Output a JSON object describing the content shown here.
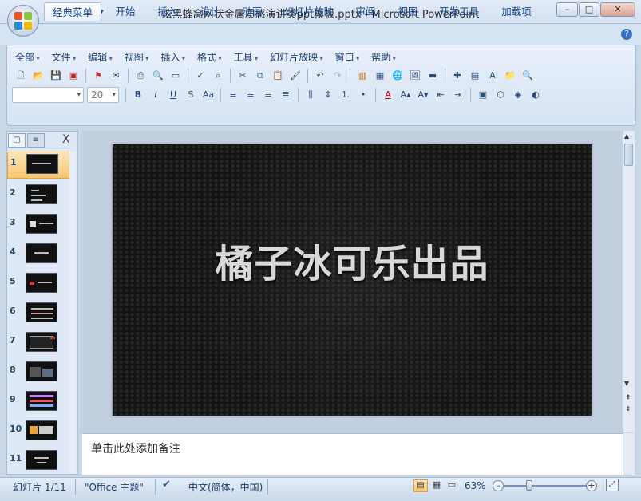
{
  "window": {
    "title": "炫黑蜂窝网状金属质感演讲类ppt模板.pptx - Microsoft PowerPoint",
    "minimize_icon": "minimize-icon",
    "maximize_icon": "maximize-icon",
    "close_icon": "close-icon"
  },
  "quick_access": [
    "save-icon",
    "undo-icon",
    "redo-icon",
    "customize-icon"
  ],
  "tabs": [
    {
      "label": "经典菜单",
      "active": true
    },
    {
      "label": "开始"
    },
    {
      "label": "插入"
    },
    {
      "label": "设计"
    },
    {
      "label": "动画"
    },
    {
      "label": "幻灯片放映"
    },
    {
      "label": "审阅"
    },
    {
      "label": "视图"
    },
    {
      "label": "开发工具"
    },
    {
      "label": "加载项"
    }
  ],
  "classic_menu": [
    "全部",
    "文件",
    "编辑",
    "视图",
    "插入",
    "格式",
    "工具",
    "幻灯片放映",
    "窗口",
    "帮助"
  ],
  "font_combo": {
    "font_name": "",
    "font_size": "20"
  },
  "slides_pane": {
    "close_label": "X",
    "thumbnails": [
      "1",
      "2",
      "3",
      "4",
      "5",
      "6",
      "7",
      "8",
      "9",
      "10",
      "11"
    ],
    "selected": 1
  },
  "slide": {
    "title": "橘子冰可乐出品"
  },
  "notes": {
    "placeholder": "单击此处添加备注"
  },
  "status": {
    "slide_info": "幻灯片 1/11",
    "theme": "\"Office 主题\"",
    "language": "中文(简体，中国)",
    "zoom": "63%"
  },
  "colors": {
    "accent": "#15428b",
    "ribbon_bg": "#d6e3f3",
    "slide_bg": "#141414",
    "selected_thumb": "#f6c56f"
  }
}
